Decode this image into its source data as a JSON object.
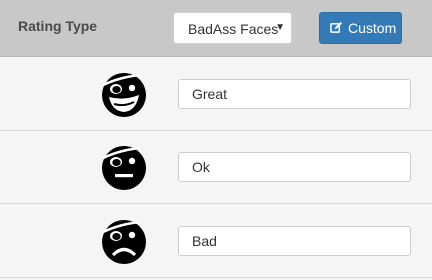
{
  "header": {
    "label": "Rating Type",
    "select": {
      "value": "BadAss Faces",
      "caret": "▼"
    },
    "custom_button": {
      "label": "Custom",
      "icon": "edit-square-icon",
      "color": "#337ab7"
    }
  },
  "ratings": [
    {
      "icon": "pirate-grin-face-icon",
      "value": "Great"
    },
    {
      "icon": "pirate-neutral-face-icon",
      "value": "Ok"
    },
    {
      "icon": "pirate-frown-face-icon",
      "value": "Bad"
    }
  ]
}
